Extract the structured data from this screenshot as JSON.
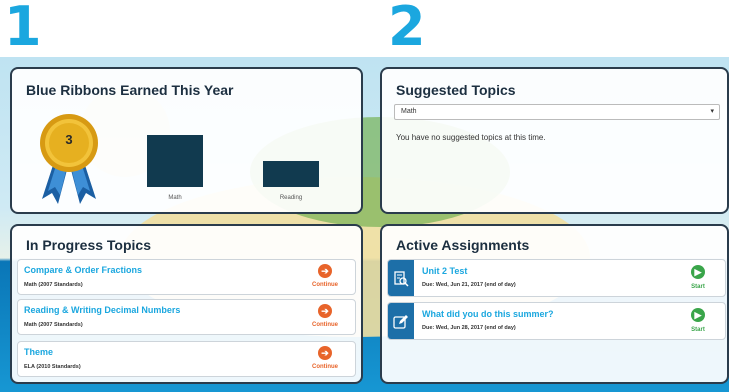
{
  "callouts": [
    "1",
    "2"
  ],
  "ribbons_panel": {
    "title": "Blue Ribbons Earned This Year",
    "ribbon_count": "3",
    "chart_data": {
      "type": "bar",
      "categories": [
        "Math",
        "Reading"
      ],
      "values": [
        2,
        1
      ]
    }
  },
  "suggested_panel": {
    "title": "Suggested Topics",
    "select_value": "Math",
    "empty_message": "You have no suggested topics at this time."
  },
  "progress_panel": {
    "title": "In Progress Topics",
    "action_label": "Continue",
    "items": [
      {
        "title": "Compare & Order Fractions",
        "subtitle": "Math (2007 Standards)"
      },
      {
        "title": "Reading & Writing Decimal Numbers",
        "subtitle": "Math (2007 Standards)"
      },
      {
        "title": "Theme",
        "subtitle": "ELA (2010 Standards)"
      }
    ]
  },
  "assignments_panel": {
    "title": "Active Assignments",
    "action_label": "Start",
    "items": [
      {
        "title": "Unit 2 Test",
        "due": "Due: Wed, Jun 21, 2017 (end of day)",
        "icon": "test-icon"
      },
      {
        "title": "What did you do this summer?",
        "due": "Due: Wed, Jun 28, 2017 (end of day)",
        "icon": "write-icon"
      }
    ]
  },
  "colors": {
    "accent": "#1ba7df",
    "continue": "#e8642a",
    "start": "#3aa54a",
    "bar": "#113a4f",
    "ribbon_gold": "#e6b020",
    "ribbon_blue": "#1b5fa3"
  }
}
